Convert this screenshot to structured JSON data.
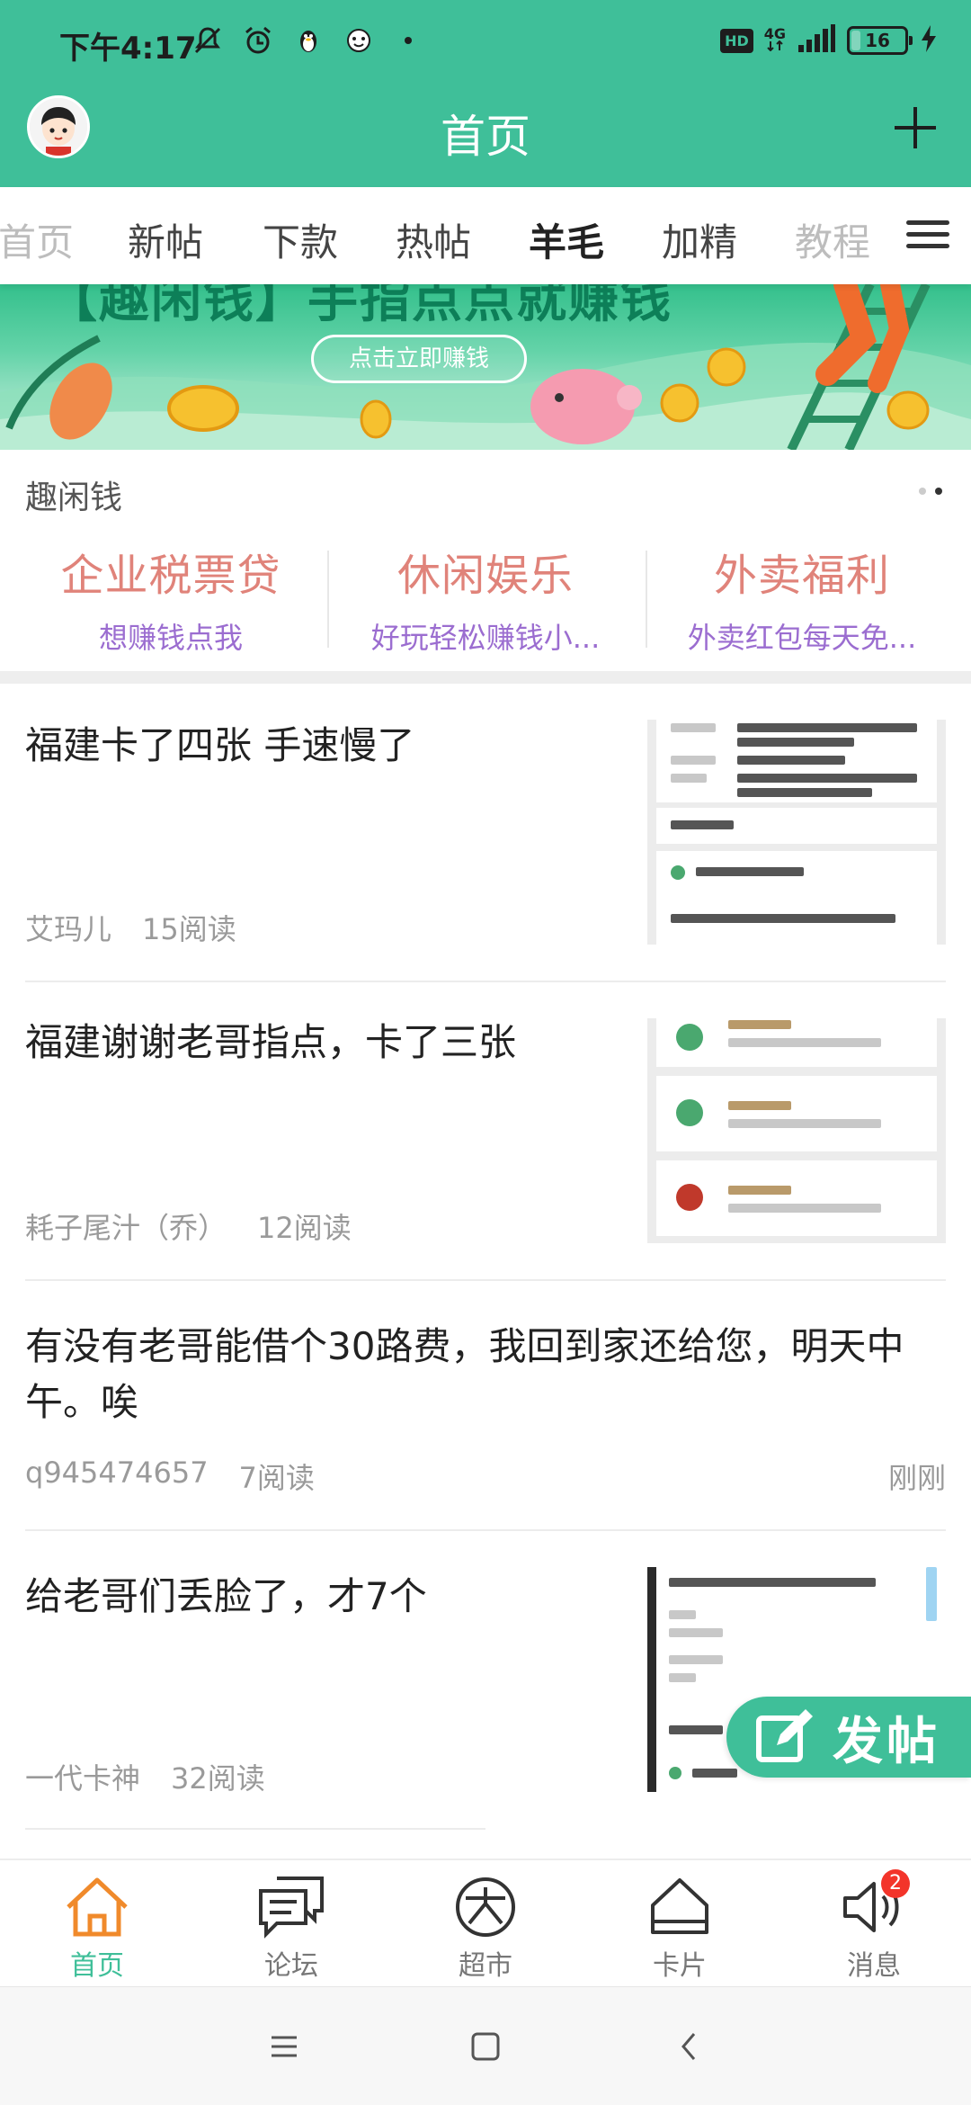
{
  "status_bar": {
    "time": "下午4:17",
    "hd": "HD",
    "network": "4G",
    "battery": "16",
    "battery_level": 0.16
  },
  "header": {
    "title": "首页"
  },
  "tabs": [
    {
      "label": "首页",
      "state": "partial"
    },
    {
      "label": "新帖"
    },
    {
      "label": "下款"
    },
    {
      "label": "热帖"
    },
    {
      "label": "羊毛",
      "state": "active"
    },
    {
      "label": "加精"
    },
    {
      "label": "教程",
      "state": "partial"
    }
  ],
  "banner": {
    "headline": "【趣闲钱】手指点点就赚钱",
    "cta": "点击立即赚钱"
  },
  "section": {
    "label": "趣闲钱",
    "items": [
      {
        "title": "企业税票贷",
        "subtitle": "想赚钱点我"
      },
      {
        "title": "休闲娱乐",
        "subtitle": "好玩轻松赚钱小..."
      },
      {
        "title": "外卖福利",
        "subtitle": "外卖红包每天免..."
      }
    ]
  },
  "posts": [
    {
      "title": "福建卡了四张 手速慢了",
      "author": "艾玛儿",
      "reads": "15阅读",
      "time": ""
    },
    {
      "title": "福建谢谢老哥指点，卡了三张",
      "author": "耗子尾汁（乔）",
      "reads": "12阅读",
      "time": ""
    },
    {
      "title": "有没有老哥能借个30路费，我回到家还给您，明天中午。唉",
      "author": "q945474657",
      "reads": "7阅读",
      "time": "刚刚"
    },
    {
      "title": "给老哥们丢脸了，才7个",
      "author": "一代卡神",
      "reads": "32阅读",
      "time": ""
    }
  ],
  "fab": {
    "label": "发帖"
  },
  "bottom_nav": [
    {
      "label": "首页",
      "icon": "home-icon",
      "active": true
    },
    {
      "label": "论坛",
      "icon": "chat-icon"
    },
    {
      "label": "超市",
      "icon": "market-icon"
    },
    {
      "label": "卡片",
      "icon": "card-icon"
    },
    {
      "label": "消息",
      "icon": "speaker-icon",
      "badge": "2"
    }
  ],
  "colors": {
    "brand": "#3fbf99",
    "active_orange": "#f08a2b",
    "quick_title": "#e0837a",
    "quick_sub": "#9b6dd0",
    "badge": "#f3342a"
  }
}
